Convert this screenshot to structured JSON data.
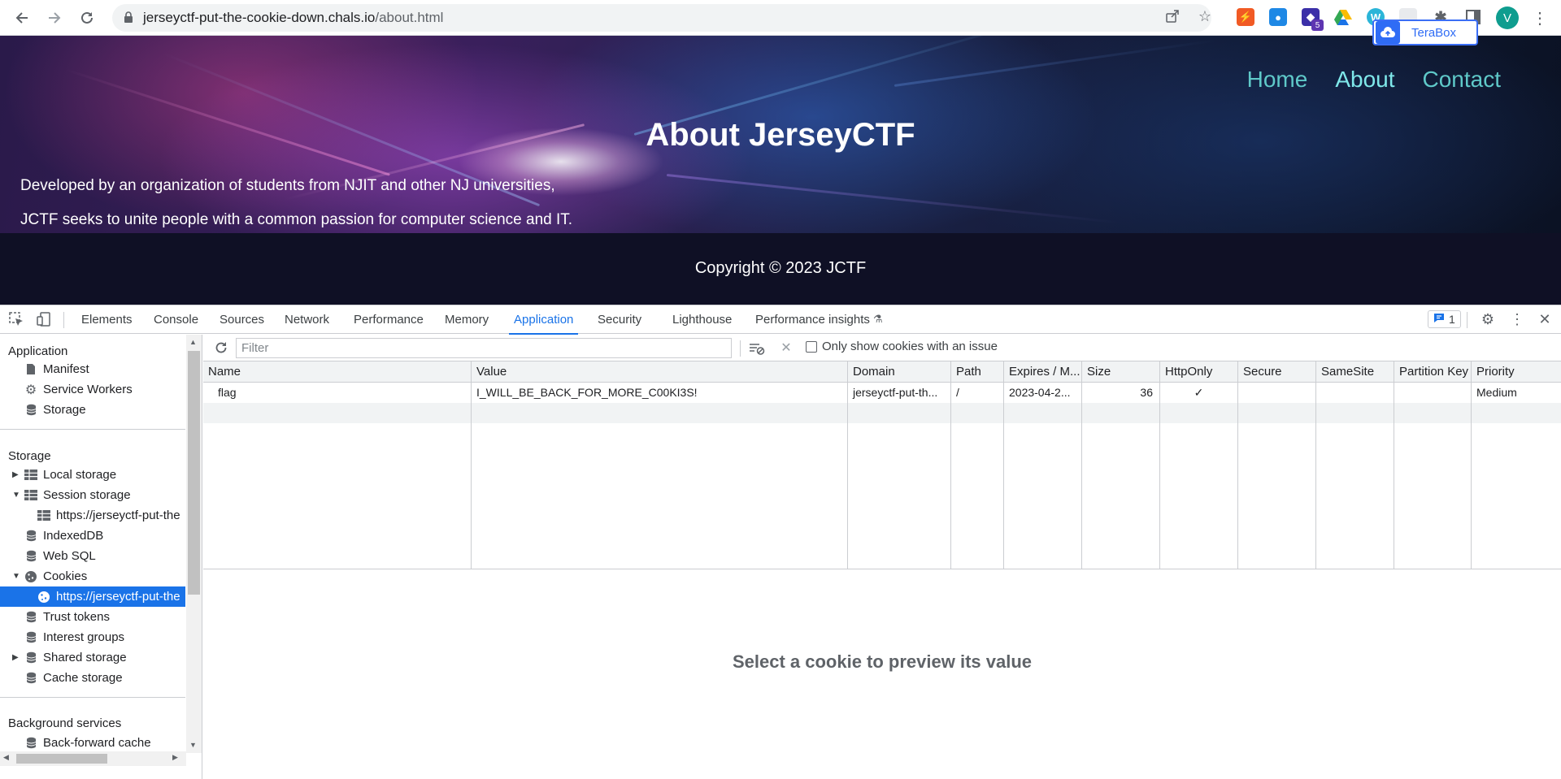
{
  "browser": {
    "url_host": "jerseyctf-put-the-cookie-down.chals.io",
    "url_path": "/about.html",
    "profile_initial": "V",
    "extension_badge": "5",
    "terabox_label": "TeraBox"
  },
  "site": {
    "nav": [
      "Home",
      "About",
      "Contact"
    ],
    "active_nav": "About",
    "title": "About JerseyCTF",
    "paragraph_1": "Developed by an organization of students from NJIT and other NJ universities,",
    "paragraph_2": "JCTF seeks to unite people with a common passion for computer science and IT.",
    "copyright": "Copyright © 2023 JCTF"
  },
  "devtools": {
    "tabs": [
      "Elements",
      "Console",
      "Sources",
      "Network",
      "Performance",
      "Memory",
      "Application",
      "Security",
      "Lighthouse",
      "Performance insights"
    ],
    "active_tab": "Application",
    "issues_count": "1",
    "sidebar": {
      "application_header": "Application",
      "application_items": [
        "Manifest",
        "Service Workers",
        "Storage"
      ],
      "storage_header": "Storage",
      "storage_items": {
        "local_storage": "Local storage",
        "session_storage": "Session storage",
        "session_origin": "https://jerseyctf-put-the",
        "indexeddb": "IndexedDB",
        "web_sql": "Web SQL",
        "cookies": "Cookies",
        "cookies_origin": "https://jerseyctf-put-the",
        "trust_tokens": "Trust tokens",
        "interest_groups": "Interest groups",
        "shared_storage": "Shared storage",
        "cache_storage": "Cache storage"
      },
      "background_header": "Background services",
      "background_items": [
        "Back-forward cache"
      ]
    },
    "cookies": {
      "filter_placeholder": "Filter",
      "issue_only_label": "Only show cookies with an issue",
      "columns": [
        "Name",
        "Value",
        "Domain",
        "Path",
        "Expires / M...",
        "Size",
        "HttpOnly",
        "Secure",
        "SameSite",
        "Partition Key",
        "Priority"
      ],
      "rows": [
        {
          "name": "flag",
          "value": "I_WILL_BE_BACK_FOR_MORE_C00KI3S!",
          "domain": "jerseyctf-put-th...",
          "path": "/",
          "expires": "2023-04-2...",
          "size": "36",
          "httponly": "✓",
          "secure": "",
          "samesite": "",
          "partition_key": "",
          "priority": "Medium"
        }
      ],
      "preview_message": "Select a cookie to preview its value"
    }
  }
}
